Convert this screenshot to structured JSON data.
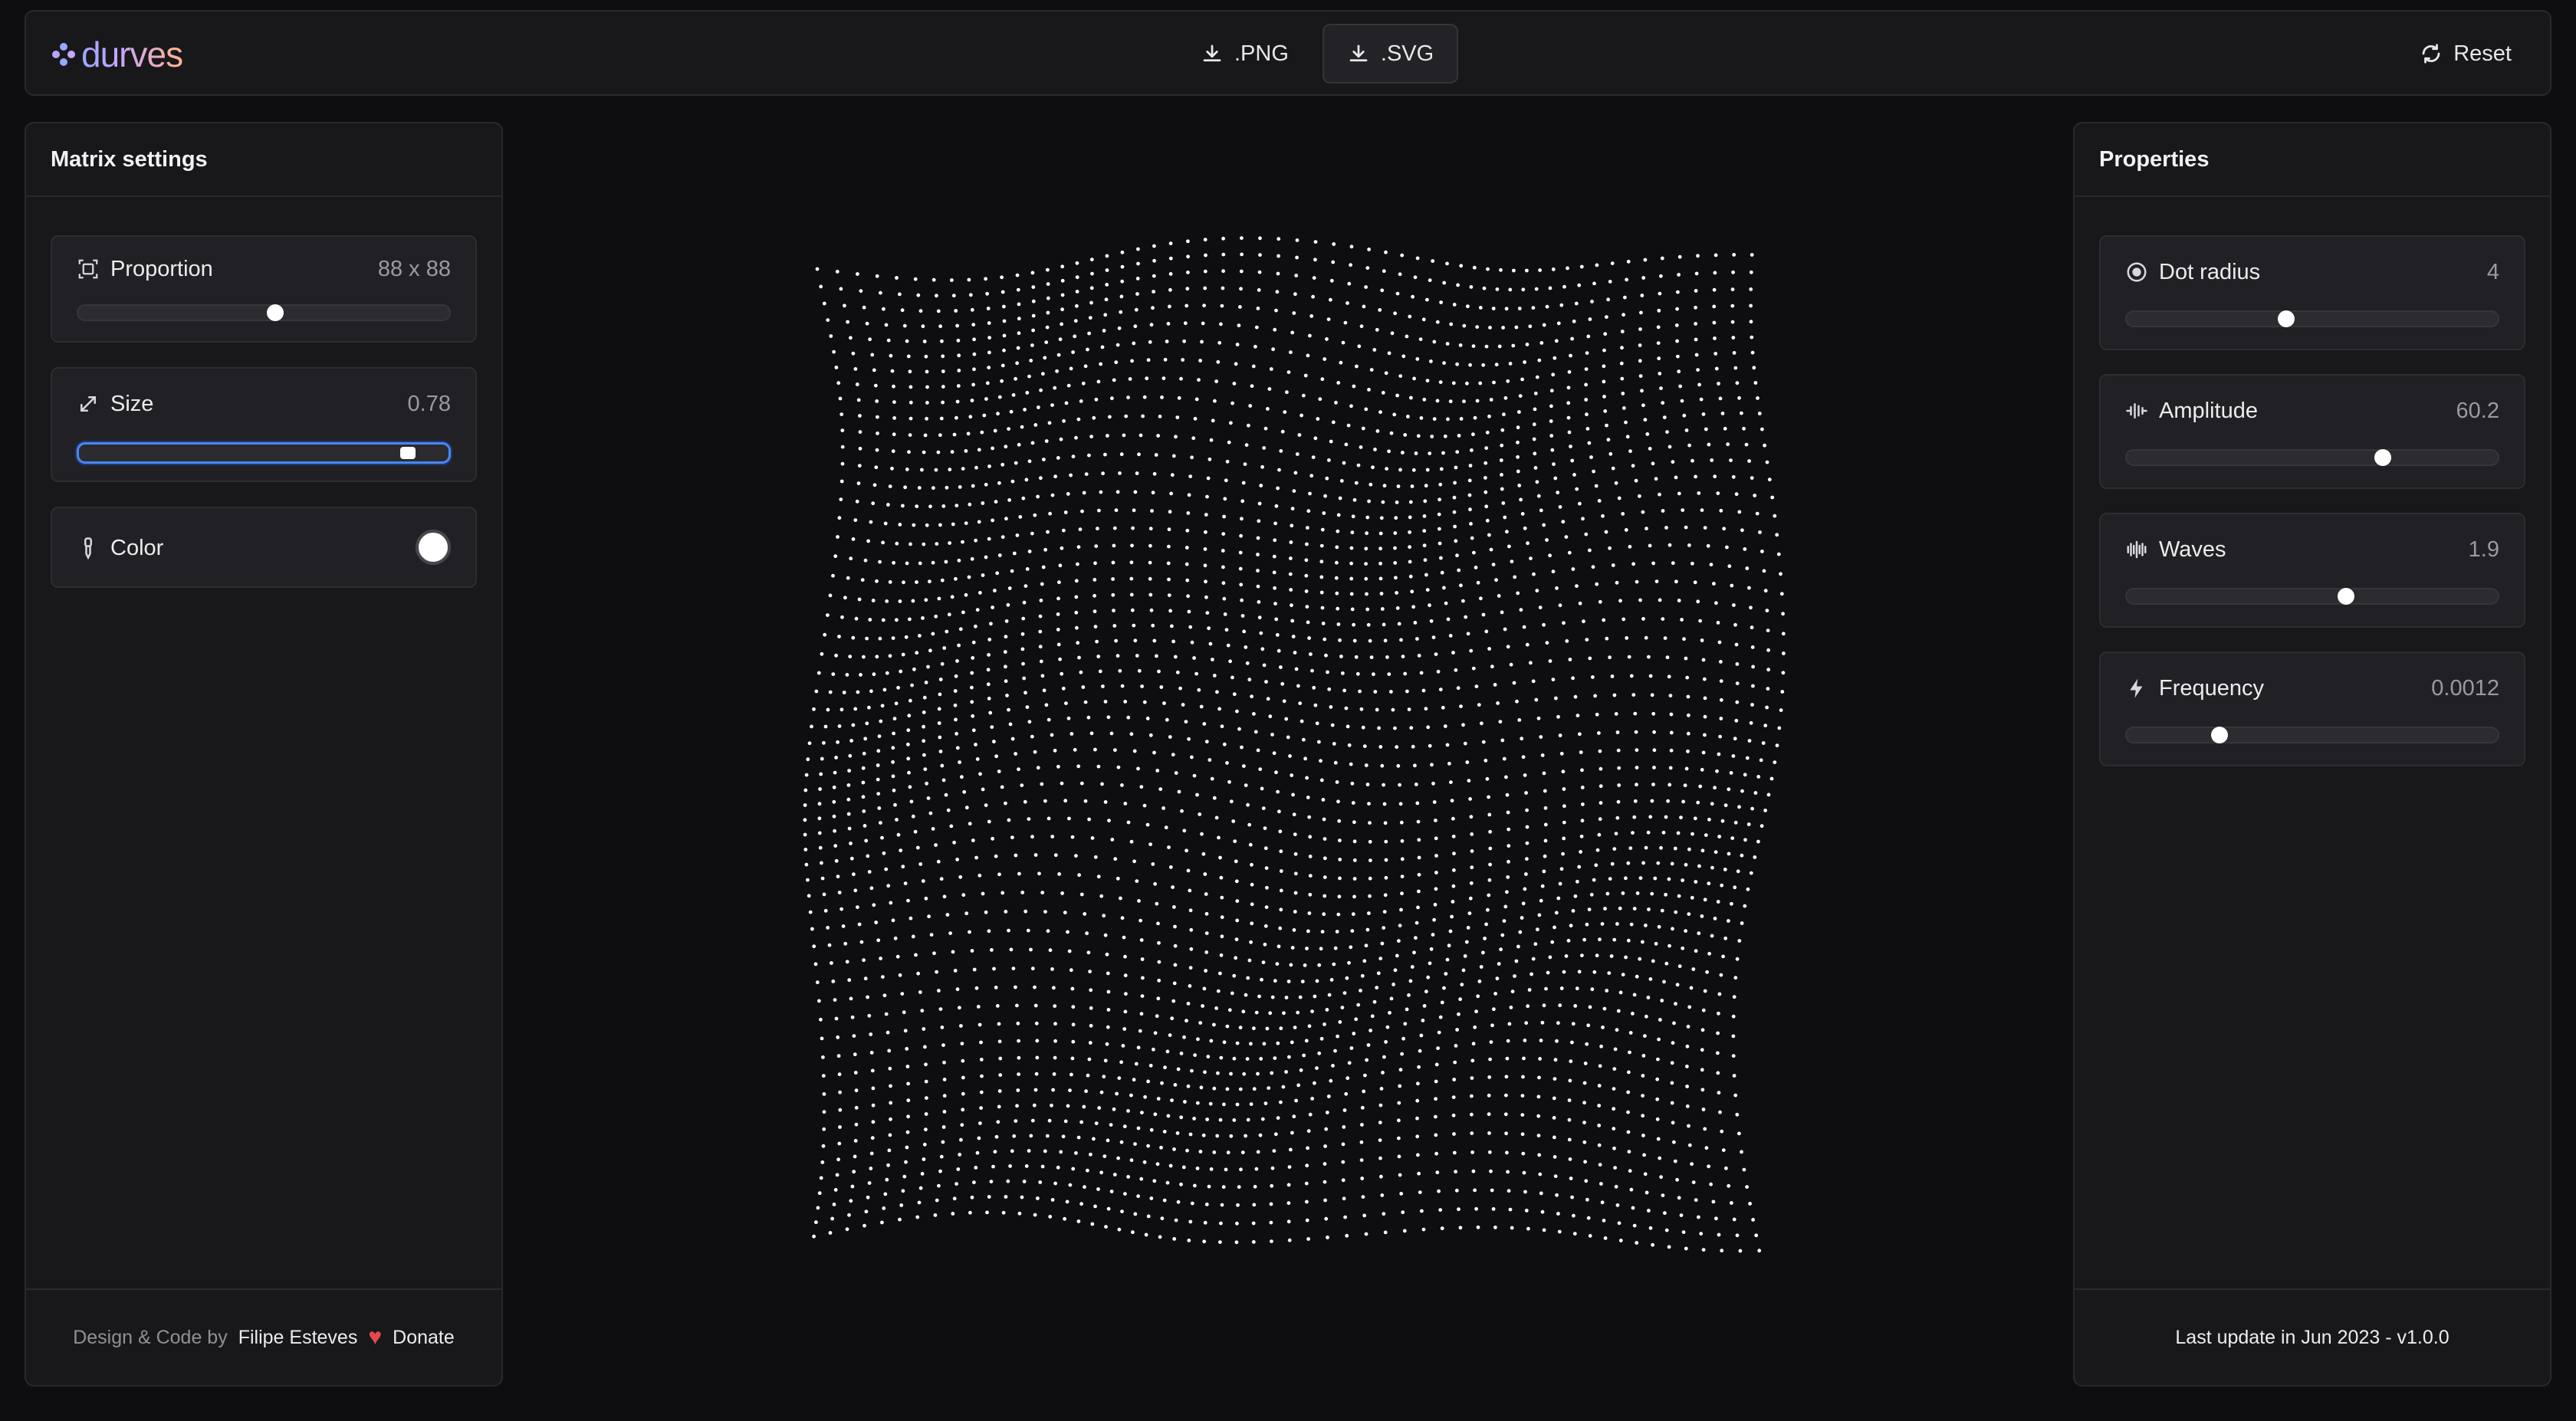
{
  "app": {
    "name": "durves"
  },
  "toolbar": {
    "png_label": ".PNG",
    "svg_label": ".SVG",
    "reset_label": "Reset"
  },
  "matrix_settings": {
    "title": "Matrix settings",
    "proportion": {
      "label": "Proportion",
      "value": "88 x 88",
      "level": 0.53
    },
    "size": {
      "label": "Size",
      "value": "0.78",
      "level": 0.89
    },
    "color": {
      "label": "Color",
      "value": "#ffffff"
    },
    "footer": {
      "design_by": "Design & Code by",
      "author": "Filipe Esteves",
      "donate": "Donate"
    }
  },
  "properties": {
    "title": "Properties",
    "dot_radius": {
      "label": "Dot radius",
      "value": "4",
      "level": 0.43
    },
    "amplitude": {
      "label": "Amplitude",
      "value": "60.2",
      "level": 0.69
    },
    "waves": {
      "label": "Waves",
      "value": "1.9",
      "level": 0.59
    },
    "frequency": {
      "label": "Frequency",
      "value": "0.0012",
      "level": 0.25
    },
    "footer": {
      "last_update": "Last update in Jun 2023 - v1.0.0"
    }
  },
  "colors": {
    "background": "#0e0e10",
    "panel": "#18181b",
    "card": "#212125",
    "accent": "#4a86f5",
    "dot": "#ffffff",
    "heart": "#e5484d"
  }
}
